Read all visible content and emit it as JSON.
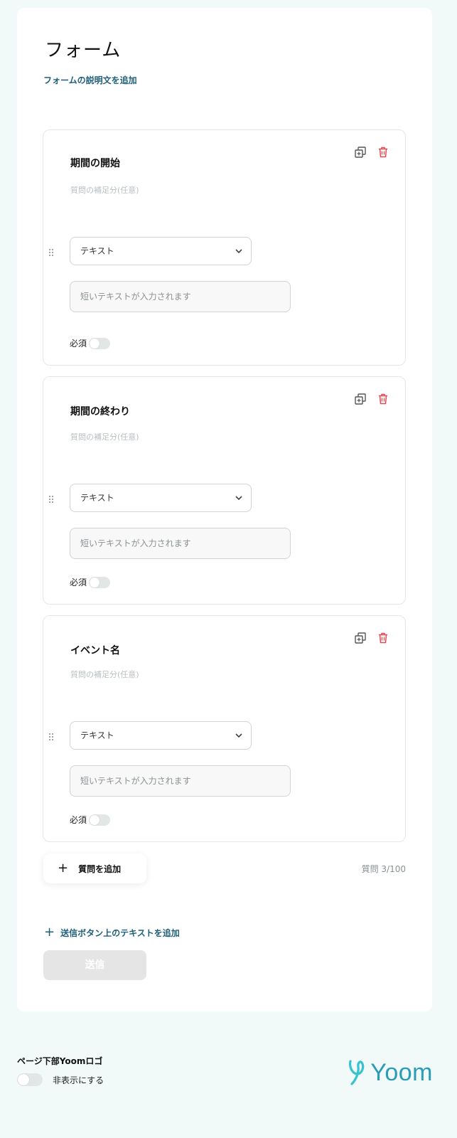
{
  "form": {
    "title": "フォーム",
    "description_link": "フォームの説明文を追加"
  },
  "questions": [
    {
      "title": "期間の開始",
      "subtitle": "質問の補足分(任意)",
      "type_label": "テキスト",
      "input_placeholder": "短いテキストが入力されます",
      "required_label": "必須",
      "required": false
    },
    {
      "title": "期間の終わり",
      "subtitle": "質問の補足分(任意)",
      "type_label": "テキスト",
      "input_placeholder": "短いテキストが入力されます",
      "required_label": "必須",
      "required": false
    },
    {
      "title": "イベント名",
      "subtitle": "質問の補足分(任意)",
      "type_label": "テキスト",
      "input_placeholder": "短いテキストが入力されます",
      "required_label": "必須",
      "required": false
    }
  ],
  "add_question": {
    "icon": "plus-icon",
    "label": "質問を追加"
  },
  "question_count": "質問 3/100",
  "submit_text_link": {
    "icon": "plus-icon",
    "label": "送信ボタン上のテキストを追加"
  },
  "submit_button": "送信",
  "footer": {
    "title": "ページ下部Yoomロゴ",
    "toggle_label": "非表示にする",
    "toggle_on": false,
    "logo_text": "Yoom"
  },
  "colors": {
    "accent": "#1f5f78",
    "delete": "#e04b55",
    "logo": "#2a9cb5",
    "background": "#f1f9f9"
  }
}
